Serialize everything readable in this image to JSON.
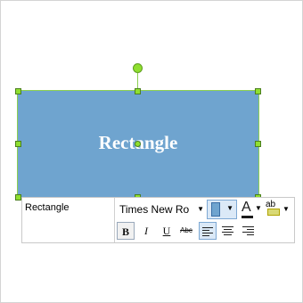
{
  "shape": {
    "label": "Rectangle",
    "fill_color": "#6fa4cf",
    "selection_color": "#8fdf2f"
  },
  "toolbar": {
    "text_value": "Rectangle",
    "font_name": "Times New Ro",
    "bold_label": "B",
    "italic_label": "I",
    "underline_label": "U",
    "strike_label": "Abc",
    "font_color_label": "A",
    "highlight_label": "ab",
    "icons": [
      "fill-color-icon",
      "font-color-icon",
      "highlight-icon",
      "align-left-icon",
      "align-center-icon",
      "align-right-icon"
    ]
  }
}
